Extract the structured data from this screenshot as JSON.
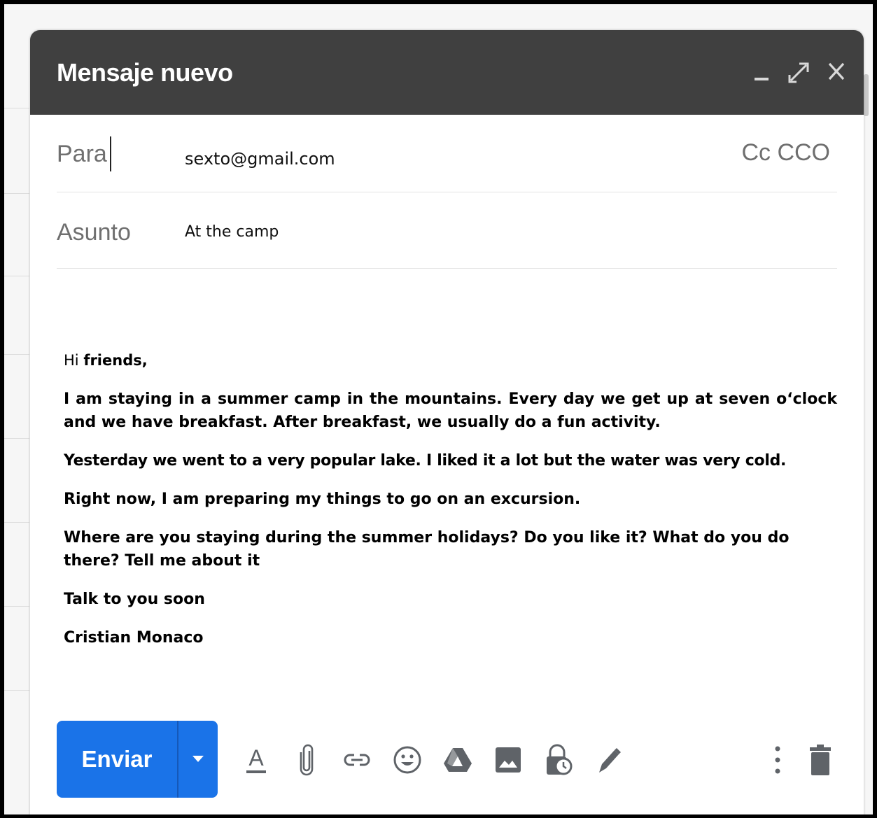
{
  "window": {
    "title": "Mensaje nuevo",
    "minimize_icon": "minimize-icon",
    "expand_icon": "expand-icon",
    "close_icon": "close-icon"
  },
  "to": {
    "label": "Para",
    "value": "sexto@gmail.com",
    "cc_bcc": "Cc CCO"
  },
  "subject": {
    "label": "Asunto",
    "value": "At the camp"
  },
  "message": {
    "greeting_plain": "Hi ",
    "greeting_bold": "friends,",
    "paragraphs": [
      "I am staying in a summer camp in the mountains. Every day we get up at seven o‘clock and we have breakfast. After breakfast, we usually do a fun activity.",
      "Yesterday we went to a very popular lake. I liked it a lot but the water was very cold.",
      "Right now, I am preparing my things to go on an excursion.",
      "Where are you staying during the summer holidays? Do you like it? What do you do there? Tell me about it",
      "Talk to you soon",
      "Cristian Monaco"
    ]
  },
  "toolbar": {
    "send_label": "Enviar",
    "accent": "#1a73e8",
    "tools": [
      "format-text-icon",
      "attach-icon",
      "link-icon",
      "emoji-icon",
      "drive-icon",
      "photo-icon",
      "confidential-icon",
      "signature-icon"
    ],
    "more_icon": "more-options-icon",
    "trash_icon": "trash-icon"
  }
}
